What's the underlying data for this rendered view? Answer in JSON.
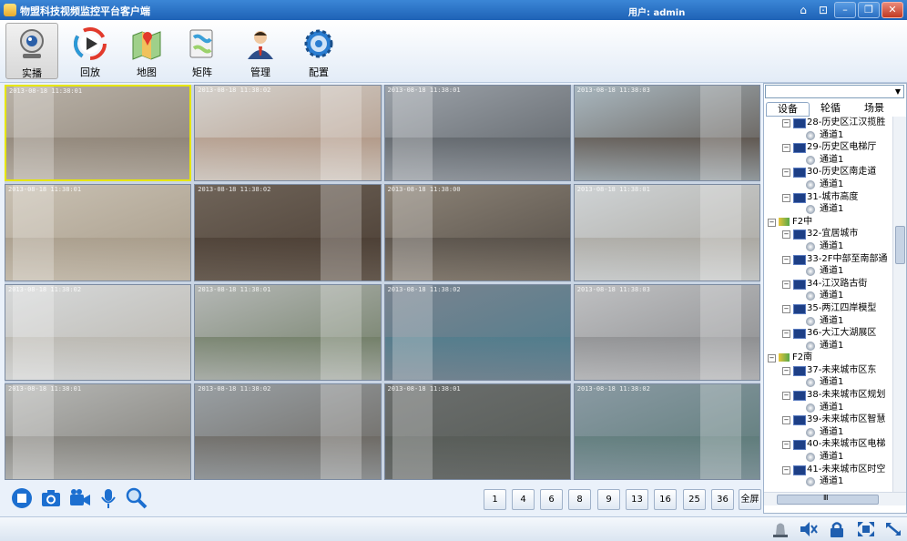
{
  "window": {
    "title": "物盟科技视频监控平台客户端",
    "user": "用户: admin",
    "buttons": {
      "home": "⌂",
      "lock": "⊡",
      "minimize": "–",
      "restore": "❐",
      "close": "✕"
    }
  },
  "toolbar": [
    {
      "label": "实播",
      "icon": "webcam-icon",
      "active": true
    },
    {
      "label": "回放",
      "icon": "playback-icon",
      "active": false
    },
    {
      "label": "地图",
      "icon": "map-icon",
      "active": false
    },
    {
      "label": "矩阵",
      "icon": "matrix-icon",
      "active": false
    },
    {
      "label": "管理",
      "icon": "admin-user-icon",
      "active": false
    },
    {
      "label": "配置",
      "icon": "settings-gear-icon",
      "active": false
    }
  ],
  "cameras": [
    {
      "ts": "2013-08-18 11:38:01"
    },
    {
      "ts": "2013-08-18 11:38:02"
    },
    {
      "ts": "2013-08-18 11:38:01"
    },
    {
      "ts": "2013-08-18 11:38:03"
    },
    {
      "ts": "2013-08-18 11:38:01"
    },
    {
      "ts": "2013-08-18 11:38:02"
    },
    {
      "ts": "2013-08-18 11:38:00"
    },
    {
      "ts": "2013-08-18 11:38:01"
    },
    {
      "ts": "2013-08-18 11:38:02"
    },
    {
      "ts": "2013-08-18 11:38:01"
    },
    {
      "ts": "2013-08-18 11:38:02"
    },
    {
      "ts": "2013-08-18 11:38:03"
    },
    {
      "ts": "2013-08-18 11:38:01"
    },
    {
      "ts": "2013-08-18 11:38:02"
    },
    {
      "ts": "2013-08-18 11:38:01"
    },
    {
      "ts": "2013-08-18 11:38:02"
    }
  ],
  "side": {
    "combo_value": "",
    "tabs": [
      "设备",
      "轮循",
      "场景"
    ],
    "tree": [
      {
        "type": "device",
        "label": "28-历史区江汉揽胜"
      },
      {
        "type": "channel",
        "label": "通道1"
      },
      {
        "type": "device",
        "label": "29-历史区电梯厅"
      },
      {
        "type": "channel",
        "label": "通道1"
      },
      {
        "type": "device",
        "label": "30-历史区南走道"
      },
      {
        "type": "channel",
        "label": "通道1"
      },
      {
        "type": "device",
        "label": "31-城市高度"
      },
      {
        "type": "channel",
        "label": "通道1"
      },
      {
        "type": "group",
        "label": "F2中"
      },
      {
        "type": "device",
        "label": "32-宜居城市"
      },
      {
        "type": "channel",
        "label": "通道1"
      },
      {
        "type": "device",
        "label": "33-2F中部至南部通"
      },
      {
        "type": "channel",
        "label": "通道1"
      },
      {
        "type": "device",
        "label": "34-江汉路古街"
      },
      {
        "type": "channel",
        "label": "通道1"
      },
      {
        "type": "device",
        "label": "35-两江四岸模型"
      },
      {
        "type": "channel",
        "label": "通道1"
      },
      {
        "type": "device",
        "label": "36-大江大湖展区"
      },
      {
        "type": "channel",
        "label": "通道1"
      },
      {
        "type": "group",
        "label": "F2南"
      },
      {
        "type": "device",
        "label": "37-未来城市区东"
      },
      {
        "type": "channel",
        "label": "通道1"
      },
      {
        "type": "device",
        "label": "38-未来城市区规划"
      },
      {
        "type": "channel",
        "label": "通道1"
      },
      {
        "type": "device",
        "label": "39-未来城市区智慧"
      },
      {
        "type": "channel",
        "label": "通道1"
      },
      {
        "type": "device",
        "label": "40-未来城市区电梯"
      },
      {
        "type": "channel",
        "label": "通道1"
      },
      {
        "type": "device",
        "label": "41-未来城市区时空"
      },
      {
        "type": "channel",
        "label": "通道1"
      }
    ],
    "hscroll_glyph": "Ⅲ"
  },
  "pages": [
    "1",
    "4",
    "6",
    "8",
    "9",
    "13",
    "16",
    "25",
    "36",
    "全屏"
  ],
  "controls": [
    "stop-icon",
    "snapshot-camera-icon",
    "record-video-icon",
    "microphone-icon",
    "zoom-search-icon"
  ],
  "status": [
    "alarm-light-icon",
    "mute-speaker-icon",
    "lock-icon",
    "fit-screen-icon",
    "expand-icon"
  ],
  "colors": {
    "title_bar": "#1e62b6",
    "selected_cell": "#e6e600",
    "accent": "#1f5fb0"
  }
}
